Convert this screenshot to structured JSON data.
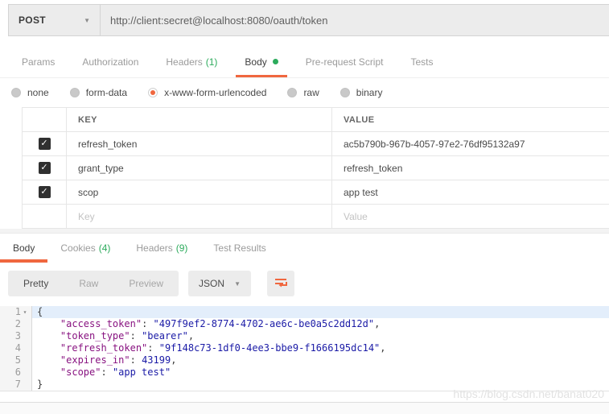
{
  "request": {
    "method": "POST",
    "url": "http://client:secret@localhost:8080/oauth/token",
    "tabs": [
      {
        "label": "Params",
        "count": "",
        "active": false,
        "dot": false
      },
      {
        "label": "Authorization",
        "count": "",
        "active": false,
        "dot": false
      },
      {
        "label": "Headers",
        "count": "(1)",
        "active": false,
        "dot": false
      },
      {
        "label": "Body",
        "count": "",
        "active": true,
        "dot": true
      },
      {
        "label": "Pre-request Script",
        "count": "",
        "active": false,
        "dot": false
      },
      {
        "label": "Tests",
        "count": "",
        "active": false,
        "dot": false
      }
    ],
    "body_modes": [
      {
        "label": "none",
        "selected": false
      },
      {
        "label": "form-data",
        "selected": false
      },
      {
        "label": "x-www-form-urlencoded",
        "selected": true
      },
      {
        "label": "raw",
        "selected": false
      },
      {
        "label": "binary",
        "selected": false
      }
    ],
    "kv_table": {
      "key_header": "KEY",
      "value_header": "VALUE",
      "rows": [
        {
          "checked": true,
          "placeholder": false,
          "key": "refresh_token",
          "value": "ac5b790b-967b-4057-97e2-76df95132a97"
        },
        {
          "checked": true,
          "placeholder": false,
          "key": "grant_type",
          "value": "refresh_token"
        },
        {
          "checked": true,
          "placeholder": false,
          "key": "scop",
          "value": "app test"
        },
        {
          "checked": false,
          "placeholder": true,
          "key": "Key",
          "value": "Value"
        }
      ]
    }
  },
  "response": {
    "tabs": [
      {
        "label": "Body",
        "count": "",
        "active": true
      },
      {
        "label": "Cookies",
        "count": "(4)",
        "active": false
      },
      {
        "label": "Headers",
        "count": "(9)",
        "active": false
      },
      {
        "label": "Test Results",
        "count": "",
        "active": false
      }
    ],
    "toolbar": {
      "views": [
        {
          "label": "Pretty",
          "active": true
        },
        {
          "label": "Raw",
          "active": false
        },
        {
          "label": "Preview",
          "active": false
        }
      ],
      "language": "JSON",
      "wrap_icon": "wrap-text-icon"
    },
    "body_json": {
      "lines": [
        {
          "num": 1,
          "fold": true,
          "active": true,
          "tokens": [
            {
              "t": "p",
              "v": "{"
            }
          ]
        },
        {
          "num": 2,
          "fold": false,
          "active": false,
          "tokens": [
            {
              "t": "p",
              "v": "    "
            },
            {
              "t": "k",
              "v": "\"access_token\""
            },
            {
              "t": "p",
              "v": ": "
            },
            {
              "t": "s",
              "v": "\"497f9ef2-8774-4702-ae6c-be0a5c2dd12d\""
            },
            {
              "t": "p",
              "v": ","
            }
          ]
        },
        {
          "num": 3,
          "fold": false,
          "active": false,
          "tokens": [
            {
              "t": "p",
              "v": "    "
            },
            {
              "t": "k",
              "v": "\"token_type\""
            },
            {
              "t": "p",
              "v": ": "
            },
            {
              "t": "s",
              "v": "\"bearer\""
            },
            {
              "t": "p",
              "v": ","
            }
          ]
        },
        {
          "num": 4,
          "fold": false,
          "active": false,
          "tokens": [
            {
              "t": "p",
              "v": "    "
            },
            {
              "t": "k",
              "v": "\"refresh_token\""
            },
            {
              "t": "p",
              "v": ": "
            },
            {
              "t": "s",
              "v": "\"9f148c73-1df0-4ee3-bbe9-f1666195dc14\""
            },
            {
              "t": "p",
              "v": ","
            }
          ]
        },
        {
          "num": 5,
          "fold": false,
          "active": false,
          "tokens": [
            {
              "t": "p",
              "v": "    "
            },
            {
              "t": "k",
              "v": "\"expires_in\""
            },
            {
              "t": "p",
              "v": ": "
            },
            {
              "t": "n",
              "v": "43199"
            },
            {
              "t": "p",
              "v": ","
            }
          ]
        },
        {
          "num": 6,
          "fold": false,
          "active": false,
          "tokens": [
            {
              "t": "p",
              "v": "    "
            },
            {
              "t": "k",
              "v": "\"scope\""
            },
            {
              "t": "p",
              "v": ": "
            },
            {
              "t": "s",
              "v": "\"app test\""
            }
          ]
        },
        {
          "num": 7,
          "fold": false,
          "active": false,
          "tokens": [
            {
              "t": "p",
              "v": "}"
            }
          ]
        }
      ]
    }
  },
  "watermark": "https://blog.csdn.net/banat020",
  "colors": {
    "accent_orange": "#f0673f",
    "count_green": "#2cab5c",
    "json_key": "#881280",
    "json_string": "#1a1aa6",
    "json_number": "#1a1aa6",
    "checkbox_dark": "#303030",
    "active_line_bg": "#e3eefb"
  }
}
